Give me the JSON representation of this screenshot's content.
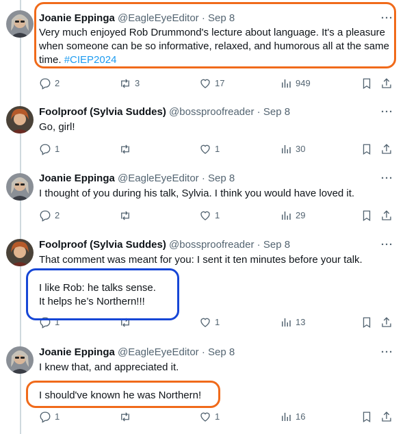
{
  "colors": {
    "accent": "#1d9bf0",
    "annotation_orange": "#f06a1a",
    "annotation_blue": "#1646d6",
    "muted": "#536471"
  },
  "tweets": [
    {
      "name": "Joanie Eppinga",
      "handle": "@EagleEyeEditor",
      "sep": "·",
      "date": "Sep 8",
      "more": "···",
      "text": "Very much enjoyed Rob Drummond's lecture about language. It's a pleasure when someone can be so informative, relaxed, and humorous all at the same time. ",
      "hashtag": "#CIEP2024",
      "replies": "2",
      "reposts": "3",
      "likes": "17",
      "views": "949"
    },
    {
      "name": "Foolproof (Sylvia Suddes)",
      "handle": "@bossproofreader",
      "sep": "·",
      "date": "Sep 8",
      "more": "···",
      "text": "Go, girl!",
      "replies": "1",
      "reposts": "",
      "likes": "1",
      "views": "30"
    },
    {
      "name": "Joanie Eppinga",
      "handle": "@EagleEyeEditor",
      "sep": "·",
      "date": "Sep 8",
      "more": "···",
      "text": "I thought of you during his talk, Sylvia. I think you would have loved it.",
      "replies": "2",
      "reposts": "",
      "likes": "1",
      "views": "29"
    },
    {
      "name": "Foolproof (Sylvia Suddes)",
      "handle": "@bossproofreader",
      "sep": "·",
      "date": "Sep 8",
      "more": "···",
      "text": "That comment was meant for you: I sent it ten minutes before your talk.",
      "text2": "I like Rob: he talks sense.",
      "text3": "It helps he’s Northern!!!",
      "replies": "1",
      "reposts": "",
      "likes": "1",
      "views": "13"
    },
    {
      "name": "Joanie Eppinga",
      "handle": "@EagleEyeEditor",
      "sep": "·",
      "date": "Sep 8",
      "more": "···",
      "text": "I knew that, and appreciated it.",
      "text2": "I should've known he was Northern!",
      "replies": "1",
      "reposts": "",
      "likes": "1",
      "views": "16"
    }
  ]
}
